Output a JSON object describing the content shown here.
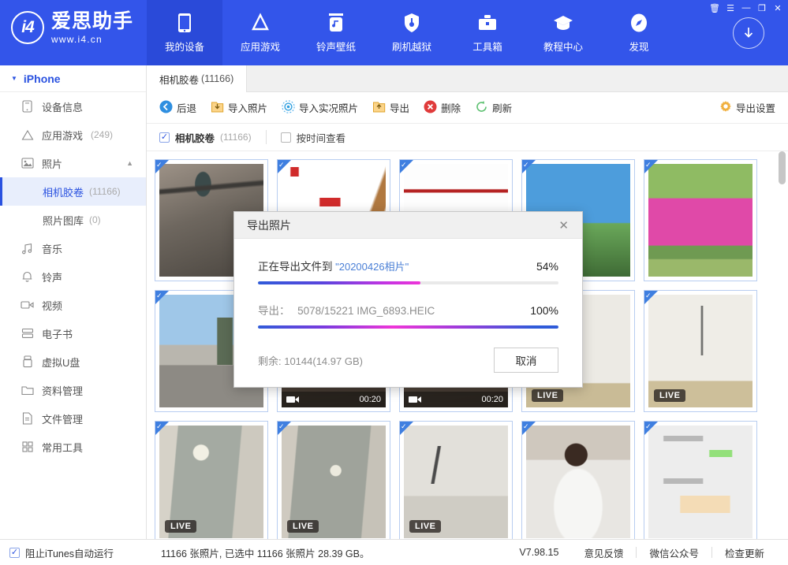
{
  "app": {
    "brand_mark": "i4",
    "brand_name": "爱思助手",
    "brand_url": "www.i4.cn"
  },
  "header": {
    "nav": [
      {
        "label": "我的设备",
        "icon": "phone-icon",
        "active": true
      },
      {
        "label": "应用游戏",
        "icon": "appstore-icon",
        "active": false
      },
      {
        "label": "铃声壁纸",
        "icon": "music-note-icon",
        "active": false
      },
      {
        "label": "刷机越狱",
        "icon": "shield-icon",
        "active": false
      },
      {
        "label": "工具箱",
        "icon": "toolbox-icon",
        "active": false
      },
      {
        "label": "教程中心",
        "icon": "graduation-cap-icon",
        "active": false
      },
      {
        "label": "发现",
        "icon": "compass-icon",
        "active": false
      }
    ],
    "window_buttons": [
      {
        "name": "trash-icon",
        "glyph": "🗑"
      },
      {
        "name": "menu-list-icon",
        "glyph": "☰"
      },
      {
        "name": "minimize-icon",
        "glyph": "―"
      },
      {
        "name": "maximize-icon",
        "glyph": "❐"
      },
      {
        "name": "close-icon",
        "glyph": "✕"
      }
    ],
    "download_button": "download-icon"
  },
  "sidebar": {
    "device": "iPhone",
    "items": [
      {
        "label": "设备信息",
        "icon": "device-info-icon",
        "count": ""
      },
      {
        "label": "应用游戏",
        "icon": "appstore-icon",
        "count": "(249)"
      },
      {
        "label": "照片",
        "icon": "photo-icon",
        "count": "",
        "expanded": true
      },
      {
        "label": "音乐",
        "icon": "music-icon",
        "count": ""
      },
      {
        "label": "铃声",
        "icon": "bell-icon",
        "count": ""
      },
      {
        "label": "视频",
        "icon": "video-icon",
        "count": ""
      },
      {
        "label": "电子书",
        "icon": "ebook-icon",
        "count": ""
      },
      {
        "label": "虚拟U盘",
        "icon": "usb-icon",
        "count": ""
      },
      {
        "label": "资料管理",
        "icon": "folder-icon",
        "count": ""
      },
      {
        "label": "文件管理",
        "icon": "file-icon",
        "count": ""
      },
      {
        "label": "常用工具",
        "icon": "grid-icon",
        "count": ""
      }
    ],
    "photo_children": [
      {
        "label": "相机胶卷",
        "count": "(11166)",
        "active": true
      },
      {
        "label": "照片图库",
        "count": "(0)",
        "active": false
      }
    ]
  },
  "tabbar": {
    "tabs": [
      {
        "label": "相机胶卷",
        "count": "(11166)",
        "active": true
      }
    ]
  },
  "toolbar": {
    "buttons": [
      {
        "label": "后退",
        "icon": "back-arrow-icon",
        "color": "#2f8fe0"
      },
      {
        "label": "导入照片",
        "icon": "import-icon",
        "color": "#f0b040"
      },
      {
        "label": "导入实况照片",
        "icon": "live-photo-icon",
        "color": "#2f9fe0"
      },
      {
        "label": "导出",
        "icon": "export-icon",
        "color": "#f0b040"
      },
      {
        "label": "删除",
        "icon": "delete-icon",
        "color": "#e03b3b"
      },
      {
        "label": "刷新",
        "icon": "refresh-icon",
        "color": "#5cc070"
      }
    ],
    "settings_label": "导出设置",
    "settings_icon": "gear-icon"
  },
  "filterbar": {
    "select_all_label": "相机胶卷",
    "select_all_count": "(11166)",
    "select_all_checked": true,
    "by_time_label": "按时间查看",
    "by_time_checked": false
  },
  "grid": {
    "cells": [
      {
        "id": 1,
        "kind": "photo",
        "badge": "",
        "selected": true,
        "desc": "ladle-on-granite"
      },
      {
        "id": 2,
        "kind": "photo",
        "badge": "",
        "selected": true,
        "desc": "wok-advertisement"
      },
      {
        "id": 3,
        "kind": "photo",
        "badge": "",
        "selected": true,
        "desc": "white-document"
      },
      {
        "id": 4,
        "kind": "photo",
        "badge": "",
        "selected": true,
        "desc": "blue-sky-trees"
      },
      {
        "id": 5,
        "kind": "photo",
        "badge": "",
        "selected": true,
        "desc": "pink-flower-field"
      },
      {
        "id": 6,
        "kind": "photo",
        "badge": "",
        "selected": true,
        "desc": "road-gas-station"
      },
      {
        "id": 7,
        "kind": "video",
        "badge": "00:20",
        "selected": true,
        "desc": "dark-video"
      },
      {
        "id": 8,
        "kind": "video",
        "badge": "00:20",
        "selected": true,
        "desc": "dark-video-2"
      },
      {
        "id": 9,
        "kind": "live",
        "badge": "LIVE",
        "selected": true,
        "desc": "handwritten-notes"
      },
      {
        "id": 10,
        "kind": "live",
        "badge": "LIVE",
        "selected": true,
        "desc": "handwritten-notes-2"
      },
      {
        "id": 11,
        "kind": "live",
        "badge": "LIVE",
        "selected": true,
        "desc": "door-hallway"
      },
      {
        "id": 12,
        "kind": "live",
        "badge": "LIVE",
        "selected": true,
        "desc": "door-closed"
      },
      {
        "id": 13,
        "kind": "live",
        "badge": "LIVE",
        "selected": true,
        "desc": "wall-writing"
      },
      {
        "id": 14,
        "kind": "photo",
        "badge": "",
        "selected": true,
        "desc": "person-white-shirt"
      },
      {
        "id": 15,
        "kind": "photo",
        "badge": "",
        "selected": true,
        "desc": "wechat-screenshot"
      }
    ]
  },
  "dialog": {
    "title": "导出照片",
    "close_icon": "close-icon",
    "overall": {
      "label": "正在导出文件到",
      "folder": "\"20200426相片\"",
      "percent_text": "54%",
      "percent": 54
    },
    "current": {
      "label": "导出：",
      "detail": "5078/15221 IMG_6893.HEIC",
      "percent_text": "100%",
      "percent": 100
    },
    "remaining": "剩余: 10144(14.97 GB)",
    "cancel_label": "取消"
  },
  "statusbar": {
    "itunes_label": "阻止iTunes自动运行",
    "itunes_checked": true,
    "summary": "11166 张照片, 已选中 11166 张照片 28.39 GB。",
    "version": "V7.98.15",
    "links": [
      "意见反馈",
      "微信公众号",
      "检查更新"
    ]
  }
}
